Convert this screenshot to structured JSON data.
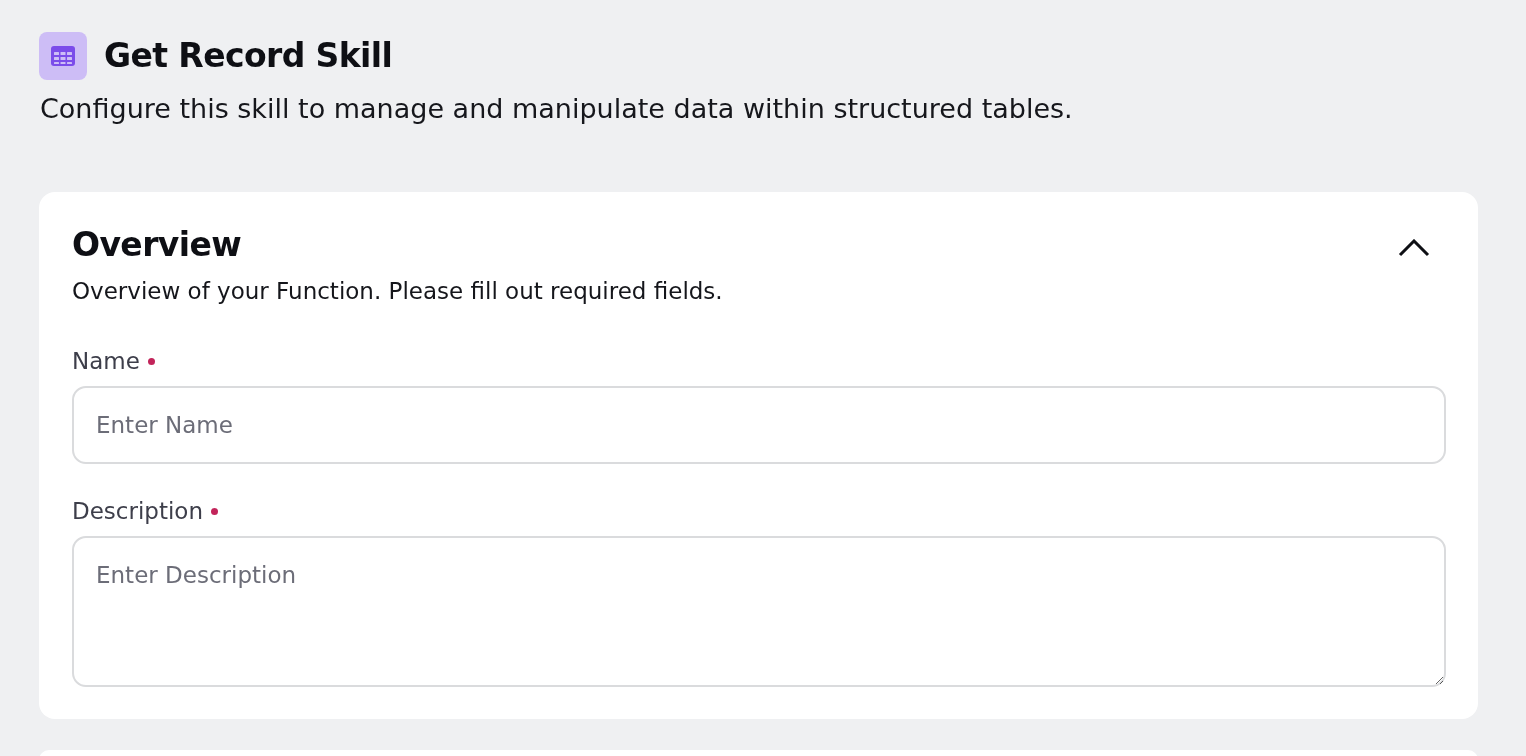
{
  "header": {
    "title": "Get Record Skill",
    "subtitle": "Configure this skill to manage and manipulate data within structured tables."
  },
  "sections": [
    {
      "title": "Overview",
      "description": "Overview of your Function. Please fill out required fields.",
      "expanded": true,
      "fields": [
        {
          "kind": "text",
          "label": "Name",
          "required": true,
          "placeholder": "Enter Name"
        },
        {
          "kind": "textarea",
          "label": "Description",
          "required": true,
          "placeholder": "Enter Description"
        }
      ]
    }
  ]
}
